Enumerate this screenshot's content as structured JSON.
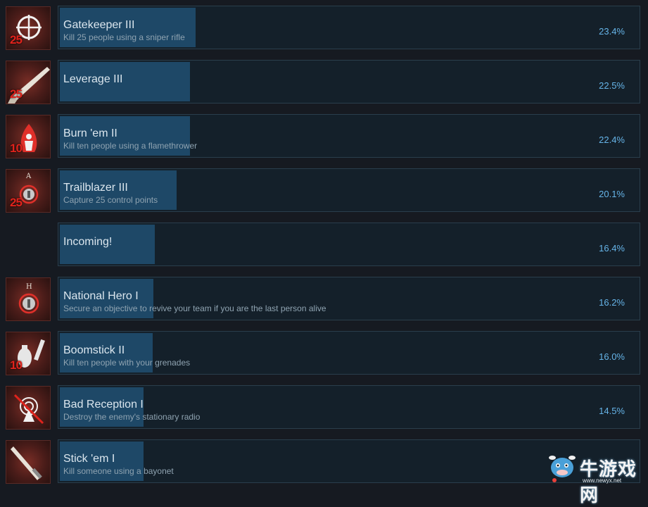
{
  "achievements": [
    {
      "title": "Gatekeeper III",
      "desc": "Kill 25 people using a sniper rifle",
      "percent": "23.4%",
      "icon": "sniper-scope-icon",
      "badge": "25",
      "progress": 0.234
    },
    {
      "title": "Leverage III",
      "desc": "",
      "percent": "22.5%",
      "icon": "rifle-icon",
      "badge": "25",
      "progress": 0.225
    },
    {
      "title": "Burn 'em II",
      "desc": "Kill ten people using a flamethrower",
      "percent": "22.4%",
      "icon": "flamethrower-icon",
      "badge": "10",
      "progress": 0.224
    },
    {
      "title": "Trailblazer III",
      "desc": "Capture 25 control points",
      "percent": "20.1%",
      "icon": "control-point-icon",
      "badge": "25",
      "progress": 0.201
    },
    {
      "title": "Incoming!",
      "desc": "",
      "percent": "16.4%",
      "icon": "",
      "badge": "",
      "progress": 0.164
    },
    {
      "title": "National Hero I",
      "desc": "Secure an objective to revive your team if you are the last person alive",
      "percent": "16.2%",
      "icon": "national-hero-icon",
      "badge": "",
      "progress": 0.162
    },
    {
      "title": "Boomstick II",
      "desc": "Kill ten people with your grenades",
      "percent": "16.0%",
      "icon": "grenade-icon",
      "badge": "10",
      "progress": 0.16
    },
    {
      "title": "Bad Reception I",
      "desc": "Destroy the enemy's stationary radio",
      "percent": "14.5%",
      "icon": "radio-icon",
      "badge": "",
      "progress": 0.145
    },
    {
      "title": "Stick 'em I",
      "desc": "Kill someone using a bayonet",
      "percent": "",
      "icon": "bayonet-icon",
      "badge": "",
      "progress": 0.145
    }
  ],
  "watermark": {
    "text": "牛游戏网",
    "url": "www.newyx.net"
  },
  "colors": {
    "bar": "#1e4867",
    "panel": "#14202a",
    "percent": "#66b4e8",
    "badge": "#e0231c"
  }
}
